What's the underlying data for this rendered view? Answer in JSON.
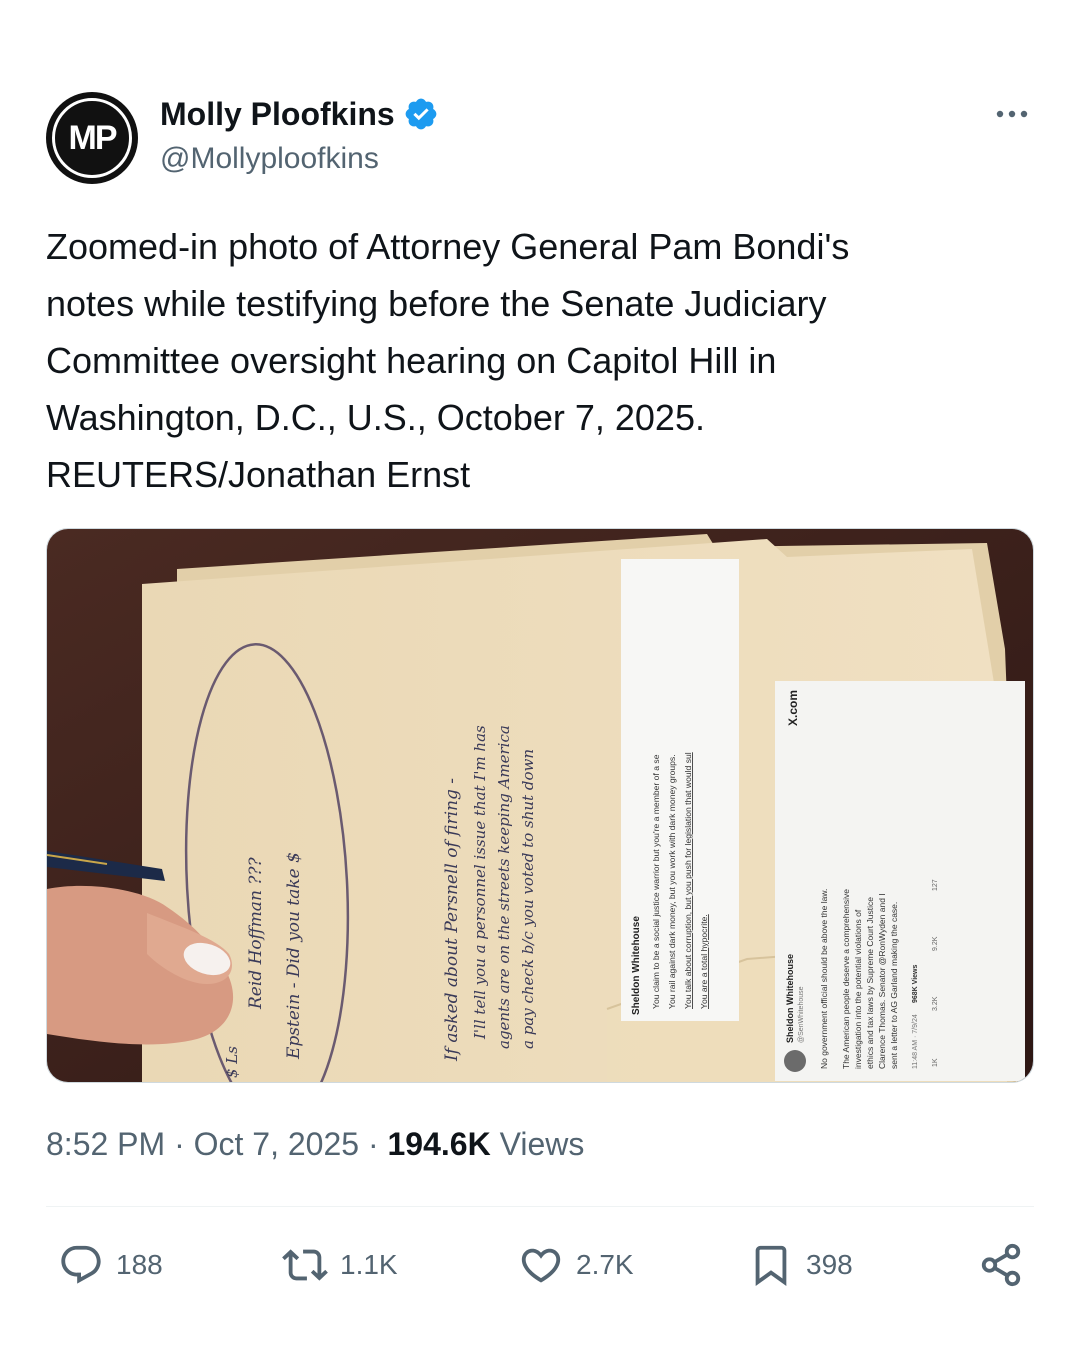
{
  "author": {
    "avatar_initials": "MP",
    "display_name": "Molly Ploofkins",
    "handle": "@Mollyploofkins"
  },
  "tweet": {
    "text": "Zoomed-in photo of Attorney General Pam Bondi's\nnotes while testifying before the Senate Judiciary\nCommittee oversight hearing on Capitol Hill in\nWashington, D.C., U.S., October 7, 2025.\nREUTERS/Jonathan Ernst",
    "time": "8:52 PM",
    "date": "Oct 7, 2025",
    "views_count": "194.6K",
    "views_label": "Views"
  },
  "photo": {
    "printout_main": {
      "name": "Sheldon Whitehouse",
      "bullets": [
        "You claim to be a social justice warrior but you're a member of a se",
        "You rail against dark money, but you work with dark money groups.",
        "You talk about corruption, but you push for legislation that would sul",
        "You are a total hypocrite."
      ]
    },
    "printout_tweet": {
      "name": "Sheldon Whitehouse",
      "handle": "@SenWhitehouse",
      "site": "X.com",
      "line1": "No government official should be above the law.",
      "body": [
        "The American people deserve a comprehensive",
        "investigation into the potential violations of",
        "ethics and tax laws by Supreme Court Justice",
        "Clarence Thomas. Senator @RonWyden and I",
        "sent a letter to AG Garland making the case."
      ],
      "stamp": "11:48 AM · 7/9/24",
      "views": "968K Views",
      "stats": [
        "1K",
        "3.2K",
        "9.2K",
        "127"
      ]
    },
    "handwriting": [
      "If asked about Persnell of firing -",
      "I'll tell you a personnel issue that I'm has",
      "agents are on the streets keeping America",
      "a pay check b/c you voted to shut down"
    ],
    "handwriting_circled": [
      "Epstein - Did you take $",
      "Reid Hoffman ???"
    ],
    "handwriting_edge": "$ Ls"
  },
  "actions": {
    "replies": "188",
    "reposts": "1.1K",
    "likes": "2.7K",
    "bookmarks": "398"
  },
  "colors": {
    "text_primary": "#0f1419",
    "text_secondary": "#536471",
    "verified_blue": "#1d9bf0"
  },
  "icons": [
    "verified-badge-icon",
    "more-icon",
    "reply-icon",
    "repost-icon",
    "like-icon",
    "bookmark-icon",
    "share-icon"
  ]
}
